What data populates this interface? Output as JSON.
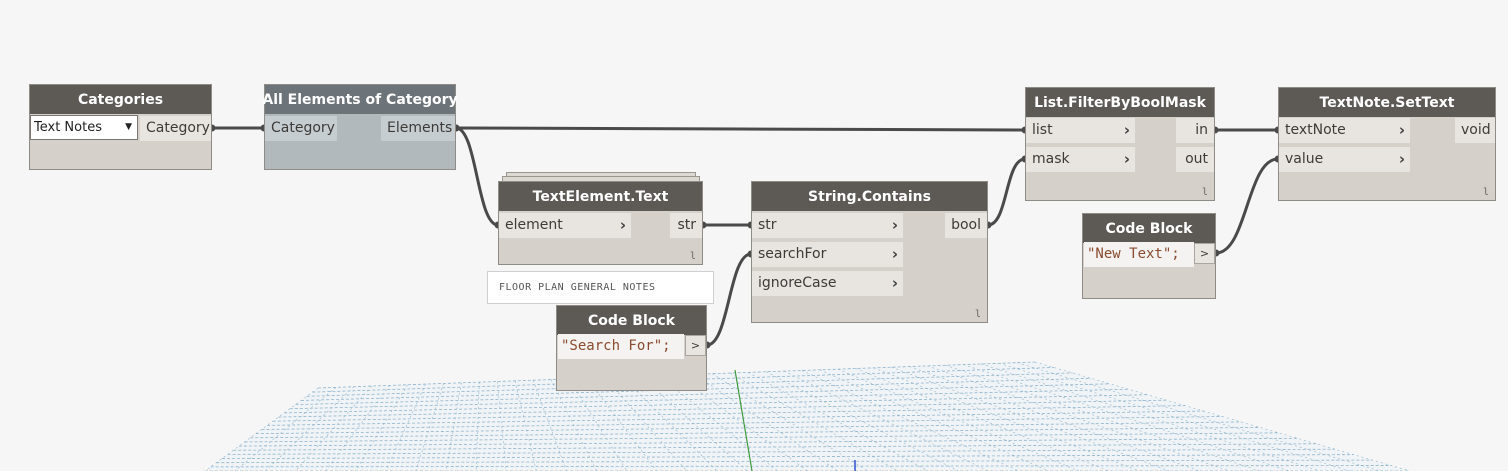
{
  "nodes": {
    "categories": {
      "title": "Categories",
      "dropdown_value": "Text Notes",
      "output": "Category"
    },
    "all_elements": {
      "title": "All Elements of Category",
      "input": "Category",
      "output": "Elements"
    },
    "text_element": {
      "title": "TextElement.Text",
      "input": "element",
      "output": "str",
      "lacing": "l",
      "preview": "FLOOR PLAN GENERAL NOTES"
    },
    "code_block_search": {
      "title": "Code Block",
      "code": "\"Search For\";",
      "output": ">"
    },
    "string_contains": {
      "title": "String.Contains",
      "inputs": [
        "str",
        "searchFor",
        "ignoreCase"
      ],
      "output": "bool",
      "lacing": "l"
    },
    "filter_by_bool_mask": {
      "title": "List.FilterByBoolMask",
      "inputs": [
        "list",
        "mask"
      ],
      "outputs": [
        "in",
        "out"
      ],
      "lacing": "l"
    },
    "code_block_new_text": {
      "title": "Code Block",
      "code": "\"New Text\";",
      "output": ">"
    },
    "textnote_settext": {
      "title": "TextNote.SetText",
      "inputs": [
        "textNote",
        "value"
      ],
      "output": "void",
      "lacing": "l"
    }
  },
  "colors": {
    "node_header": "#5d5a56",
    "node_body": "#d5d0c9",
    "frozen_header": "#6d7479",
    "frozen_body": "#b1b9bd",
    "wire": "#4a4a4a",
    "code_text": "#8a4b2f",
    "grid": "#8fb4cc",
    "axis_green": "#3f9a3f",
    "axis_blue": "#2f4fd0"
  }
}
